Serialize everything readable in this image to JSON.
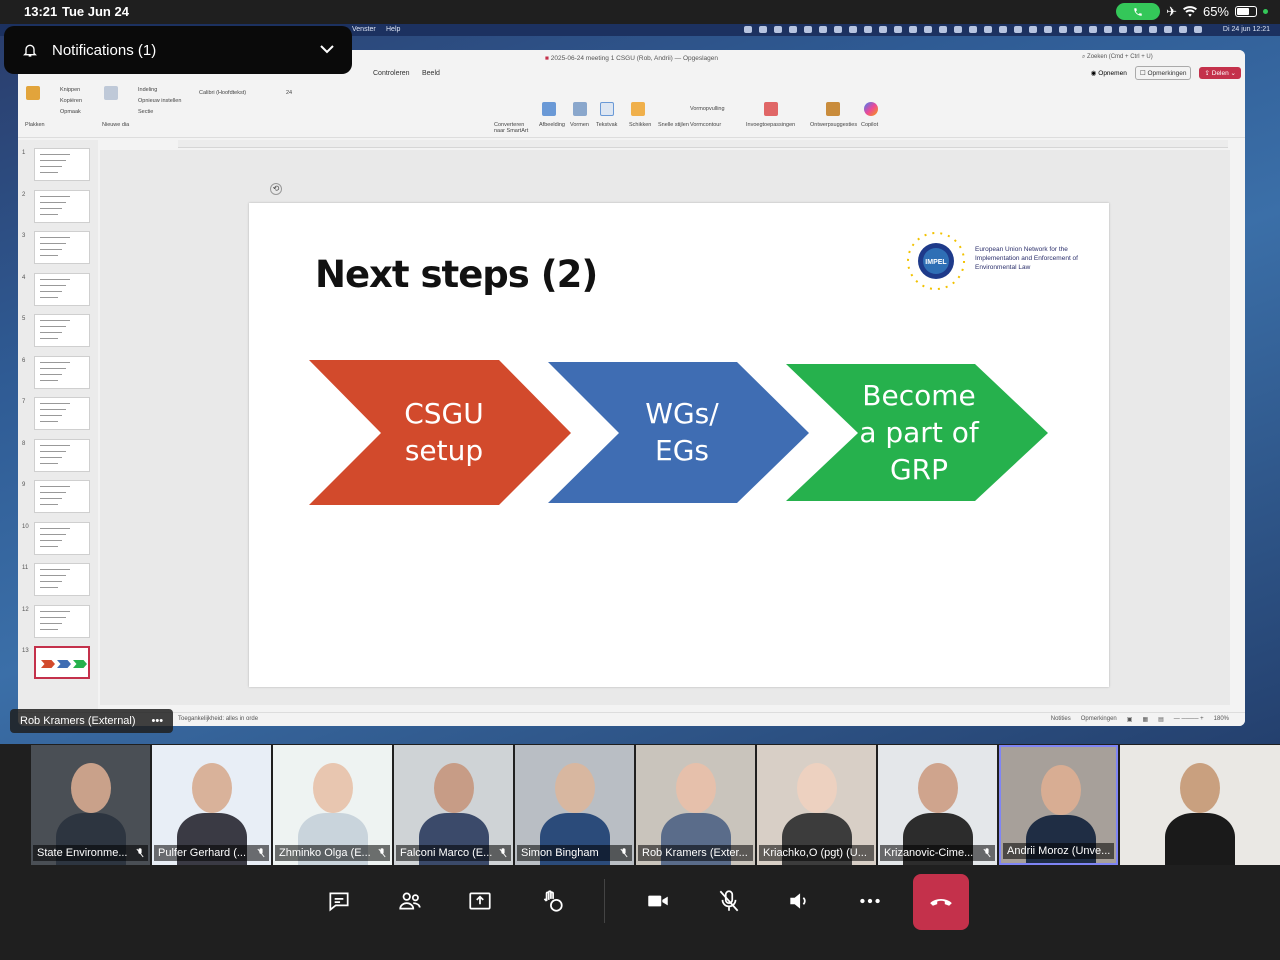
{
  "status_bar": {
    "time": "13:21",
    "date": "Tue Jun 24",
    "battery": "65%",
    "battery_level": 0.65
  },
  "mac_menubar": {
    "items": [
      "Venster",
      "Help"
    ],
    "clock": "Di 24 jun 12:21"
  },
  "ppt": {
    "window_title": "2025-06-24 meeting 1 CSGU (Rob, Andrii) — Opgeslagen",
    "search_placeholder": "Zoeken (Cmd + Ctrl + U)",
    "tabs": [
      "Controleren",
      "Beeld"
    ],
    "actions": {
      "record": "Opnemen",
      "comments": "Opmerkingen",
      "share": "Delen"
    },
    "ribbon": {
      "cut": "Knippen",
      "copy": "Kopiëren",
      "format": "Opmaak",
      "paste": "Plakken",
      "new_slide": "Nieuwe dia",
      "layout": "Indeling",
      "reset": "Opnieuw instellen",
      "section": "Sectie",
      "font": "Calibri (Hoofdtekst)",
      "font_size": "24",
      "smartart": "Converteren naar SmartArt",
      "picture": "Afbeelding",
      "shapes": "Vormen",
      "textbox": "Tekstvak",
      "arrange": "Schikken",
      "quick_styles": "Snelle stijlen",
      "fill": "Vormopvulling",
      "outline": "Vormcontour",
      "addins": "Invoegtoepassingen",
      "designer": "Ontwerpsuggesties",
      "copilot": "Copilot"
    },
    "slide_numbers": [
      "1",
      "2",
      "3",
      "4",
      "5",
      "6",
      "7",
      "8",
      "9",
      "10",
      "11",
      "12",
      "13"
    ],
    "selected_slide": "13",
    "slide": {
      "title": "Next steps (2)",
      "logo_text": "IMPEL",
      "org_text": "European Union Network for the Implementation and Enforcement of Environmental Law",
      "steps": [
        {
          "label": "CSGU setup",
          "color": "#d24a2c"
        },
        {
          "label": "WGs/ EGs",
          "color": "#3f6db3"
        },
        {
          "label": "Become a part of GRP",
          "color": "#26b14d"
        }
      ]
    },
    "status": {
      "accessibility": "Toegankelijkheid: alles in orde",
      "notes": "Notities",
      "comments": "Opmerkingen",
      "zoom": "180%"
    }
  },
  "notification": {
    "label": "Notifications (1)"
  },
  "presenter": {
    "label": "Rob Kramers (External)",
    "more": "•••"
  },
  "participants": [
    {
      "name": "State Environme...",
      "muted": true
    },
    {
      "name": "Pulfer Gerhard (...",
      "muted": true
    },
    {
      "name": "Zhminko Olga (E...",
      "muted": true
    },
    {
      "name": "Falconi Marco (E...",
      "muted": true
    },
    {
      "name": "Simon Bingham",
      "muted": true
    },
    {
      "name": "Rob Kramers (Exter...",
      "muted": false
    },
    {
      "name": "Kriachko,O (pgt) (U...",
      "muted": false
    },
    {
      "name": "Krizanovic-Cime...",
      "muted": true
    },
    {
      "name": "Andrii Moroz (Unve...",
      "muted": false
    },
    {
      "name": "",
      "muted": false
    }
  ],
  "controls": [
    "chat",
    "people",
    "share",
    "react",
    "camera",
    "mic-off",
    "speaker",
    "more",
    "leave"
  ]
}
